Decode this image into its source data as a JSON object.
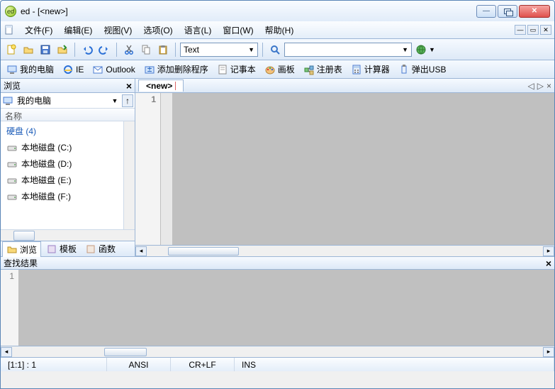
{
  "window": {
    "title": "ed - [<new>]"
  },
  "menu": {
    "file": "文件(F)",
    "edit": "编辑(E)",
    "view": "视图(V)",
    "options": "选项(O)",
    "language": "语言(L)",
    "window": "窗口(W)",
    "help": "帮助(H)"
  },
  "toolbar": {
    "syntax_combo": "Text"
  },
  "quickbar": {
    "mycomputer": "我的电脑",
    "ie": "IE",
    "outlook": "Outlook",
    "addremove": "添加删除程序",
    "notepad": "记事本",
    "paint": "画板",
    "regedit": "注册表",
    "calc": "计算器",
    "ejectusb": "弹出USB"
  },
  "sidebar": {
    "header": "浏览",
    "combo": "我的电脑",
    "col": "名称",
    "group": "硬盘 (4)",
    "drives": [
      "本地磁盘 (C:)",
      "本地磁盘 (D:)",
      "本地磁盘 (E:)",
      "本地磁盘 (F:)"
    ],
    "tabs": {
      "browse": "浏览",
      "templates": "模板",
      "functions": "函数"
    }
  },
  "editor": {
    "tab": "<new>",
    "line1": "1"
  },
  "output": {
    "header": "查找结果",
    "line1": "1"
  },
  "status": {
    "pos": "[1:1] : 1",
    "enc": "ANSI",
    "eol": "CR+LF",
    "mode": "INS"
  }
}
